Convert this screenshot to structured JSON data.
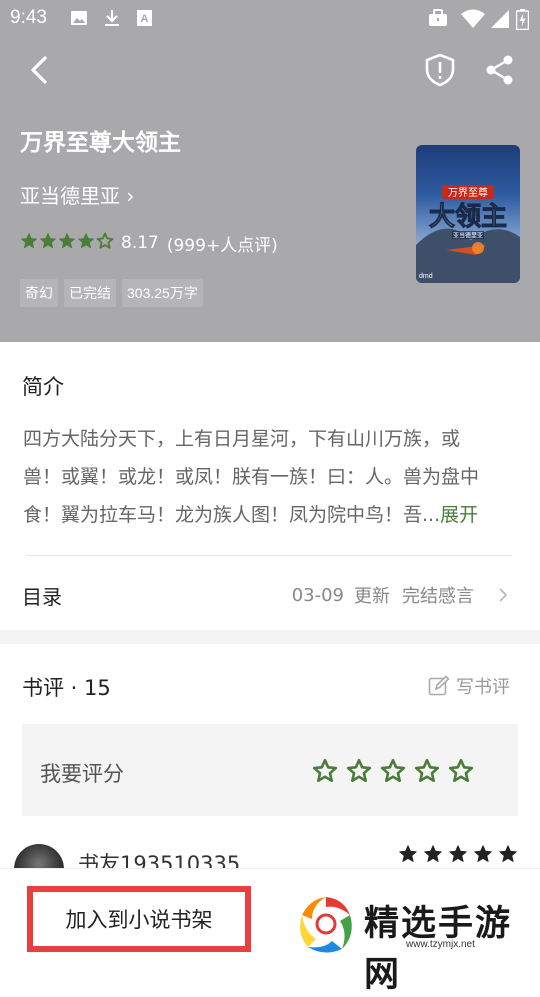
{
  "status_bar": {
    "time": "9:43",
    "notification_icons": [
      "image-icon",
      "download-icon",
      "font-icon"
    ],
    "system_icons": [
      "briefcase-icon",
      "wifi-icon",
      "signal-icon",
      "battery-charging-icon"
    ]
  },
  "toolbar": {
    "back_icon": "back-arrow-icon",
    "report_icon": "shield-alert-icon",
    "share_icon": "share-icon"
  },
  "book": {
    "title": "万界至尊大领主",
    "author": "亚当德里亚",
    "author_arrow": "›",
    "rating": "8.17",
    "rating_count": "(999+人点评)",
    "stars_filled": 4,
    "stars_half": 1,
    "tags": [
      "奇幻",
      "已完结",
      "303.25万字"
    ],
    "cover": {
      "title_art": "大领主",
      "banner": "万界至尊",
      "author": "亚当德里亚",
      "publisher_logo": "dmd"
    }
  },
  "intro": {
    "heading": "简介",
    "lines": [
      "四方大陆分天下，上有日月星河，下有山川万族，或",
      "兽！或翼！或龙！或凤！朕有一族！曰：人。兽为盘中",
      "食！翼为拉车马！龙为族人图！凤为院中鸟！吾..."
    ],
    "expand_label": "展开"
  },
  "toc": {
    "label": "目录",
    "date": "03-09",
    "update_label": "更新",
    "latest_chapter": "完结感言"
  },
  "reviews": {
    "heading": "书评 · 15",
    "write_label": "写书评",
    "rate_prompt": "我要评分",
    "first_reviewer": {
      "name": "书友193510335",
      "stars": 5
    }
  },
  "bottom": {
    "add_to_shelf": "加入到小说书架"
  },
  "watermark": {
    "text": "精选手游网",
    "url": "www.tzymjx.net"
  },
  "colors": {
    "header_bg": "#a9a8ab",
    "accent_green": "#4a7d3a",
    "highlight_red": "#e8403f"
  }
}
